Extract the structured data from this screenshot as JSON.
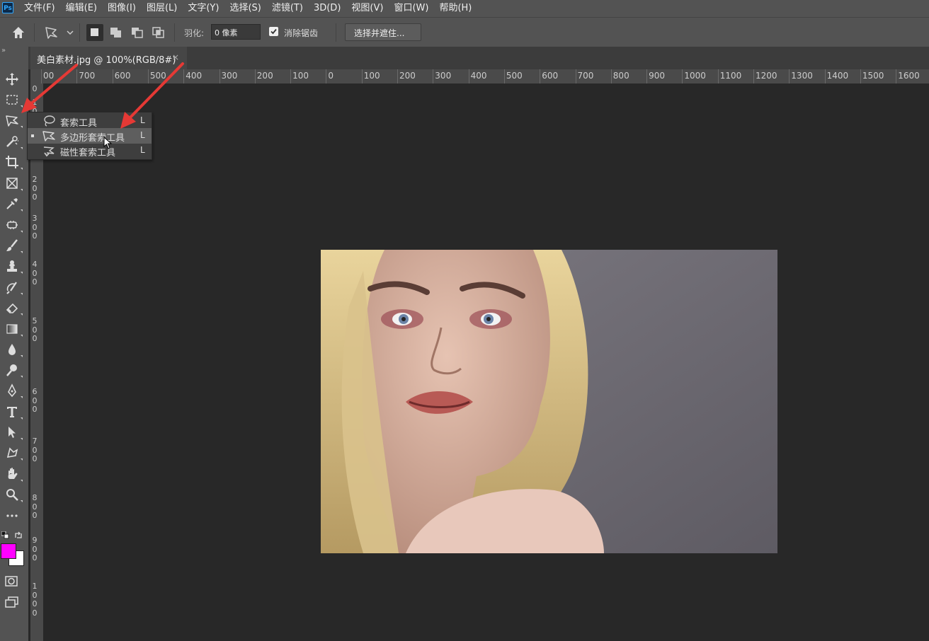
{
  "app": {
    "logo_text": "Ps"
  },
  "menu": [
    "文件(F)",
    "编辑(E)",
    "图像(I)",
    "图层(L)",
    "文字(Y)",
    "选择(S)",
    "滤镜(T)",
    "3D(D)",
    "视图(V)",
    "窗口(W)",
    "帮助(H)"
  ],
  "options": {
    "feather_label": "羽化:",
    "feather_value": "0 像素",
    "antialias_label": "消除锯齿",
    "antialias_checked": true,
    "select_mask_button": "选择并遮住..."
  },
  "document": {
    "tab_title": "美白素材.jpg @ 100%(RGB/8#)",
    "close_glyph": "×"
  },
  "ruler": {
    "top": [
      "00",
      "700",
      "600",
      "500",
      "400",
      "300",
      "200",
      "100",
      "0",
      "100",
      "200",
      "300",
      "400",
      "500",
      "600",
      "700",
      "800",
      "900",
      "1000",
      "1100",
      "1200",
      "1300",
      "1400",
      "1500",
      "1600"
    ],
    "left": [
      "0",
      "100",
      "200",
      "300",
      "400",
      "500",
      "600",
      "700",
      "800",
      "900",
      "1000"
    ]
  },
  "flyout": {
    "items": [
      {
        "label": "套索工具",
        "key": "L",
        "icon": "lasso-icon",
        "selected": false
      },
      {
        "label": "多边形套索工具",
        "key": "L",
        "icon": "polygonal-lasso-icon",
        "selected": true
      },
      {
        "label": "磁性套索工具",
        "key": "L",
        "icon": "magnetic-lasso-icon",
        "selected": false
      }
    ]
  },
  "tools": [
    "move-tool-icon",
    "marquee-tool-icon",
    "polygonal-lasso-tool-icon",
    "quick-select-tool-icon",
    "crop-tool-icon",
    "frame-tool-icon",
    "eyedropper-tool-icon",
    "healing-brush-tool-icon",
    "brush-tool-icon",
    "clone-stamp-tool-icon",
    "history-brush-tool-icon",
    "eraser-tool-icon",
    "gradient-tool-icon",
    "blur-tool-icon",
    "dodge-tool-icon",
    "pen-tool-icon",
    "type-tool-icon",
    "path-select-tool-icon",
    "shape-tool-icon",
    "hand-tool-icon",
    "zoom-tool-icon",
    "more-tools-icon"
  ],
  "colors": {
    "foreground": "#ff00ff",
    "background": "#ffffff",
    "accent_arrow": "#e53935",
    "canvas": "#282828",
    "panel": "#535353"
  }
}
